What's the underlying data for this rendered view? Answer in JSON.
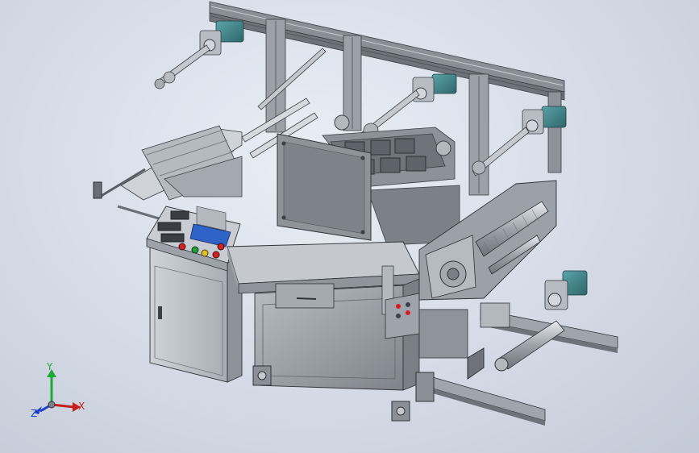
{
  "viewport": {
    "background": "#d8dee8"
  },
  "model": {
    "frame_color": "#8f929a",
    "rail_color": "#a8adb5",
    "motor_color": "#3f7f84",
    "panel_color": "#c7cbd1",
    "screen_color": "#2f63c8",
    "button_colors": [
      "#d42020",
      "#22a036",
      "#e0c020",
      "#d42020",
      "#d42020"
    ]
  },
  "triad": {
    "x_label": "X",
    "y_label": "Y",
    "z_label": "Z",
    "x_color": "#c81e1e",
    "y_color": "#1ea83a",
    "z_color": "#1e3fc8"
  }
}
